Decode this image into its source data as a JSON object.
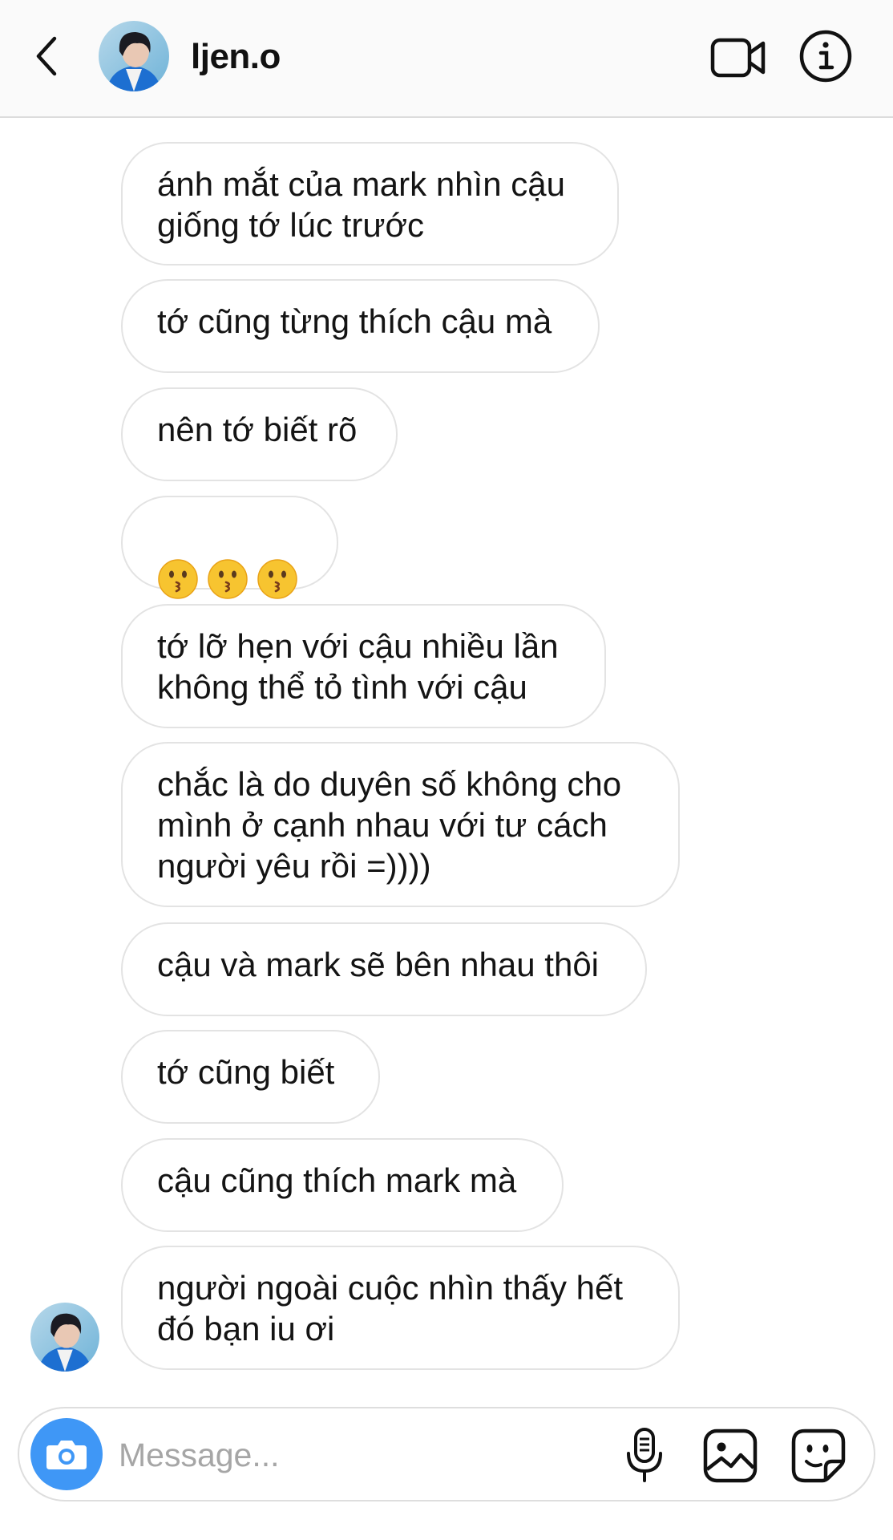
{
  "header": {
    "username": "ljen.o",
    "icons": [
      "back-arrow",
      "avatar",
      "video-camera",
      "info"
    ]
  },
  "messages": [
    {
      "text": "ánh mắt của mark nhìn cậu\ngiống tớ lúc trước"
    },
    {
      "text": "tớ cũng từng thích cậu mà"
    },
    {
      "text": "nên tớ biết rõ"
    },
    {
      "emoji": [
        "kissing-face",
        "kissing-face",
        "kissing-face"
      ]
    },
    {
      "text": "tớ lỡ hẹn với cậu nhiều lần\nkhông thể tỏ tình với cậu"
    },
    {
      "text": "chắc là do duyên số không cho\nmình ở cạnh nhau với tư cách\nngười yêu rồi =))))"
    },
    {
      "text": "cậu và mark sẽ bên nhau thôi"
    },
    {
      "text": "tớ cũng biết"
    },
    {
      "text": "cậu cũng thích mark mà"
    },
    {
      "text": "người ngoài cuộc nhìn thấy hết\nđó bạn iu ơi"
    }
  ],
  "composer": {
    "placeholder": "Message...",
    "icons": [
      "camera",
      "microphone",
      "gallery",
      "sticker"
    ]
  },
  "colors": {
    "accent": "#3f97f6",
    "header_bg": "#fafafa",
    "bubble_border": "#e3e3e3",
    "placeholder": "#a6a6a6"
  }
}
